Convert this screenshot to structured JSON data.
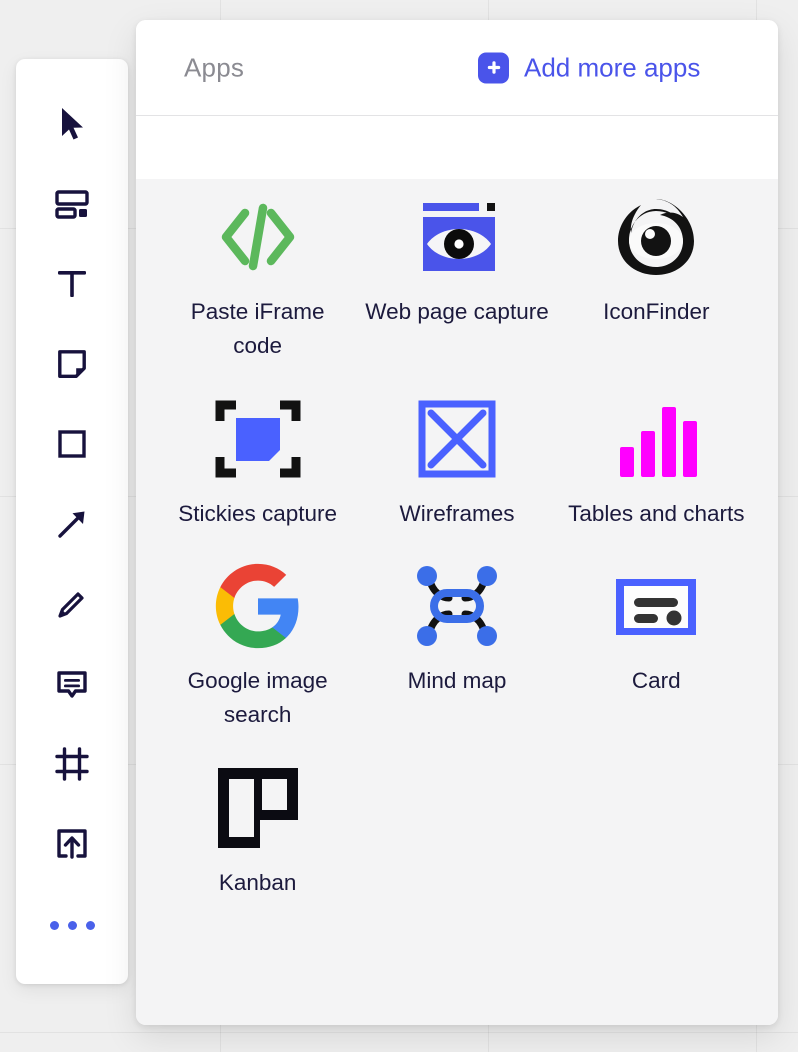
{
  "panel": {
    "title": "Apps",
    "add_more_label": "Add more apps",
    "add_icon": "plus-icon",
    "accent_color": "#4a54ea",
    "title_color": "#8b8b92",
    "panel_bg": "#ffffff",
    "grid_bg": "#f4f4f5"
  },
  "toolbar": {
    "items": [
      {
        "icon": "cursor-select-icon",
        "name": "select-tool"
      },
      {
        "icon": "template-layout-icon",
        "name": "template-tool"
      },
      {
        "icon": "text-tool-icon",
        "name": "text-tool"
      },
      {
        "icon": "sticky-note-icon",
        "name": "sticky-note-tool"
      },
      {
        "icon": "square-shape-icon",
        "name": "shape-tool"
      },
      {
        "icon": "arrow-connector-icon",
        "name": "arrow-tool"
      },
      {
        "icon": "pencil-draw-icon",
        "name": "pen-tool"
      },
      {
        "icon": "comment-bubble-icon",
        "name": "comment-tool"
      },
      {
        "icon": "frame-icon",
        "name": "frame-tool"
      },
      {
        "icon": "upload-icon",
        "name": "upload-tool"
      }
    ],
    "more_icon": "more-dots-icon",
    "icon_color": "#17123d",
    "dots_color": "#4a61ea"
  },
  "apps": [
    {
      "label": "Paste iFrame code",
      "icon": "code-brackets-icon",
      "color": "#5cb85c"
    },
    {
      "label": "Web page capture",
      "icon": "eye-capture-icon",
      "color": "#4a54ea"
    },
    {
      "label": "IconFinder",
      "icon": "iconfinder-logo-icon",
      "color": "#121212"
    },
    {
      "label": "Stickies capture",
      "icon": "stickies-capture-icon",
      "color": "#4a61ff"
    },
    {
      "label": "Wireframes",
      "icon": "wireframe-x-icon",
      "color": "#4a61ff"
    },
    {
      "label": "Tables and charts",
      "icon": "bar-chart-icon",
      "color": "#ff00ff"
    },
    {
      "label": "Google image search",
      "icon": "google-g-icon",
      "color": "#4285f4"
    },
    {
      "label": "Mind map",
      "icon": "mind-map-icon",
      "color": "#3b6ee8"
    },
    {
      "label": "Card",
      "icon": "card-icon",
      "color": "#4a61ff"
    },
    {
      "label": "Kanban",
      "icon": "kanban-board-icon",
      "color": "#0b0b12"
    }
  ]
}
